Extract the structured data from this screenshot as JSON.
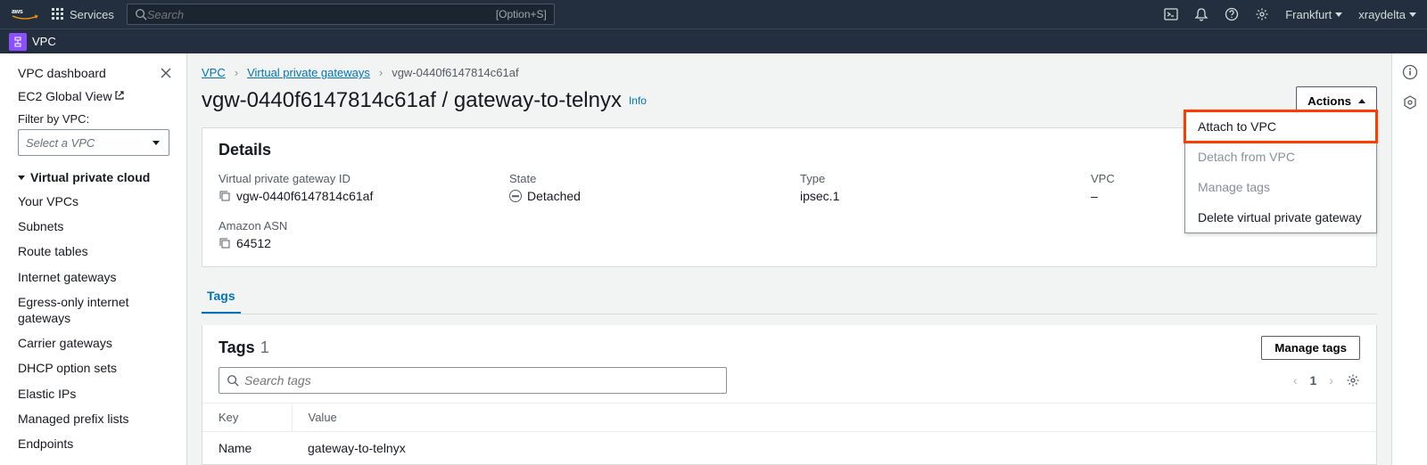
{
  "topnav": {
    "services_label": "Services",
    "search_placeholder": "Search",
    "search_shortcut": "[Option+S]",
    "region": "Frankfurt",
    "account": "xraydelta"
  },
  "subnav": {
    "service": "VPC"
  },
  "sidebar": {
    "dashboard": "VPC dashboard",
    "ec2_global": "EC2 Global View",
    "filter_label": "Filter by VPC:",
    "select_placeholder": "Select a VPC",
    "section": "Virtual private cloud",
    "items": [
      "Your VPCs",
      "Subnets",
      "Route tables",
      "Internet gateways",
      "Egress-only internet gateways",
      "Carrier gateways",
      "DHCP option sets",
      "Elastic IPs",
      "Managed prefix lists",
      "Endpoints"
    ]
  },
  "breadcrumb": {
    "a": "VPC",
    "b": "Virtual private gateways",
    "c": "vgw-0440f6147814c61af"
  },
  "page": {
    "title": "vgw-0440f6147814c61af / gateway-to-telnyx",
    "info": "Info",
    "actions_label": "Actions"
  },
  "actions_menu": {
    "attach": "Attach to VPC",
    "detach": "Detach from VPC",
    "manage": "Manage tags",
    "delete": "Delete virtual private gateway"
  },
  "details": {
    "heading": "Details",
    "vgw_id_label": "Virtual private gateway ID",
    "vgw_id_value": "vgw-0440f6147814c61af",
    "state_label": "State",
    "state_value": "Detached",
    "type_label": "Type",
    "type_value": "ipsec.1",
    "vpc_label": "VPC",
    "vpc_value": "–",
    "asn_label": "Amazon ASN",
    "asn_value": "64512"
  },
  "tabs": {
    "tags": "Tags"
  },
  "tags_panel": {
    "heading": "Tags",
    "count": "1",
    "manage_btn": "Manage tags",
    "search_placeholder": "Search tags",
    "page_num": "1",
    "col_key": "Key",
    "col_value": "Value",
    "rows": [
      {
        "k": "Name",
        "v": "gateway-to-telnyx"
      }
    ]
  }
}
